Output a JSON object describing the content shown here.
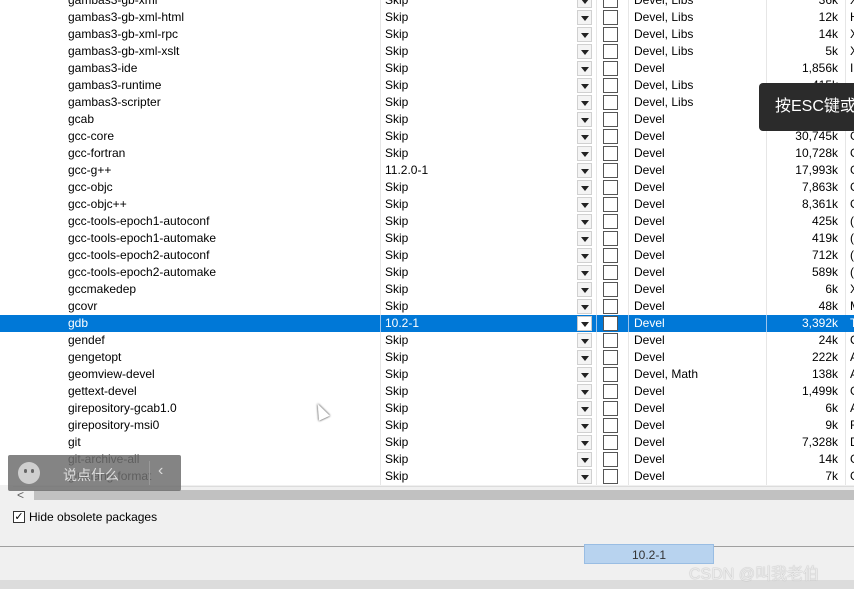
{
  "packages": [
    {
      "name": "gambas3-gb-xml",
      "version": "Skip",
      "category": "Devel, Libs",
      "size": "36k",
      "desc": "X"
    },
    {
      "name": "gambas3-gb-xml-html",
      "version": "Skip",
      "category": "Devel, Libs",
      "size": "12k",
      "desc": "H"
    },
    {
      "name": "gambas3-gb-xml-rpc",
      "version": "Skip",
      "category": "Devel, Libs",
      "size": "14k",
      "desc": "X"
    },
    {
      "name": "gambas3-gb-xml-xslt",
      "version": "Skip",
      "category": "Devel, Libs",
      "size": "5k",
      "desc": "X"
    },
    {
      "name": "gambas3-ide",
      "version": "Skip",
      "category": "Devel",
      "size": "1,856k",
      "desc": "I"
    },
    {
      "name": "gambas3-runtime",
      "version": "Skip",
      "category": "Devel, Libs",
      "size": "415k",
      "desc": ""
    },
    {
      "name": "gambas3-scripter",
      "version": "Skip",
      "category": "Devel, Libs",
      "size": "",
      "desc": ""
    },
    {
      "name": "gcab",
      "version": "Skip",
      "category": "Devel",
      "size": "",
      "desc": ""
    },
    {
      "name": "gcc-core",
      "version": "Skip",
      "category": "Devel",
      "size": "30,745k",
      "desc": "G"
    },
    {
      "name": "gcc-fortran",
      "version": "Skip",
      "category": "Devel",
      "size": "10,728k",
      "desc": "G"
    },
    {
      "name": "gcc-g++",
      "version": "11.2.0-1",
      "category": "Devel",
      "size": "17,993k",
      "desc": "G"
    },
    {
      "name": "gcc-objc",
      "version": "Skip",
      "category": "Devel",
      "size": "7,863k",
      "desc": "G"
    },
    {
      "name": "gcc-objc++",
      "version": "Skip",
      "category": "Devel",
      "size": "8,361k",
      "desc": "G"
    },
    {
      "name": "gcc-tools-epoch1-autoconf",
      "version": "Skip",
      "category": "Devel",
      "size": "425k",
      "desc": "("
    },
    {
      "name": "gcc-tools-epoch1-automake",
      "version": "Skip",
      "category": "Devel",
      "size": "419k",
      "desc": "("
    },
    {
      "name": "gcc-tools-epoch2-autoconf",
      "version": "Skip",
      "category": "Devel",
      "size": "712k",
      "desc": "("
    },
    {
      "name": "gcc-tools-epoch2-automake",
      "version": "Skip",
      "category": "Devel",
      "size": "589k",
      "desc": "("
    },
    {
      "name": "gccmakedep",
      "version": "Skip",
      "category": "Devel",
      "size": "6k",
      "desc": "X"
    },
    {
      "name": "gcovr",
      "version": "Skip",
      "category": "Devel",
      "size": "48k",
      "desc": "M"
    },
    {
      "name": "gdb",
      "version": "10.2-1",
      "category": "Devel",
      "size": "3,392k",
      "desc": "T"
    },
    {
      "name": "gendef",
      "version": "Skip",
      "category": "Devel",
      "size": "24k",
      "desc": "C"
    },
    {
      "name": "gengetopt",
      "version": "Skip",
      "category": "Devel",
      "size": "222k",
      "desc": "A"
    },
    {
      "name": "geomview-devel",
      "version": "Skip",
      "category": "Devel, Math",
      "size": "138k",
      "desc": "A"
    },
    {
      "name": "gettext-devel",
      "version": "Skip",
      "category": "Devel",
      "size": "1,499k",
      "desc": "G"
    },
    {
      "name": "girepository-gcab1.0",
      "version": "Skip",
      "category": "Devel",
      "size": "6k",
      "desc": "A"
    },
    {
      "name": "girepository-msi0",
      "version": "Skip",
      "category": "Devel",
      "size": "9k",
      "desc": "F"
    },
    {
      "name": "git",
      "version": "Skip",
      "category": "Devel",
      "size": "7,328k",
      "desc": "D"
    },
    {
      "name": "git-archive-all",
      "version": "Skip",
      "category": "Devel",
      "size": "14k",
      "desc": "G"
    },
    {
      "name": "git-clang-format",
      "version": "Skip",
      "category": "Devel",
      "size": "7k",
      "desc": "G"
    }
  ],
  "selected_index": 19,
  "hide_obsolete": {
    "label": "Hide obsolete packages",
    "checked": true,
    "mark": "✓"
  },
  "status": {
    "selected_version": "10.2-1"
  },
  "scroll": {
    "left_arrow": "<"
  },
  "overlay": {
    "esc_hint": "按ESC键或",
    "chat_placeholder": "说点什么",
    "chat_back": "‹",
    "watermark": "CSDN @叫我老伯"
  }
}
